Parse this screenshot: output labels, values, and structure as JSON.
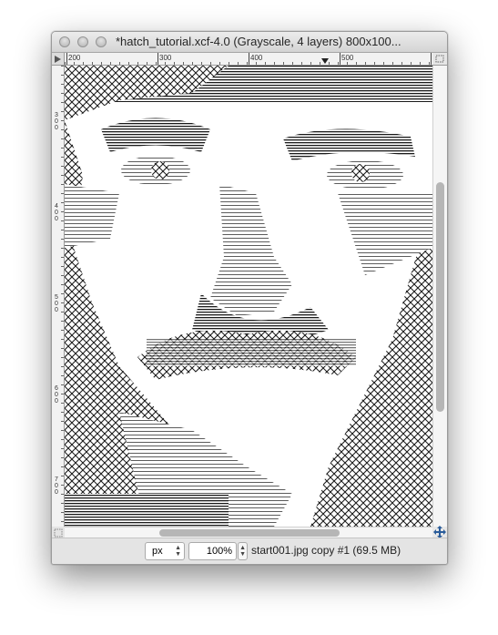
{
  "window": {
    "title": "*hatch_tutorial.xcf-4.0 (Grayscale, 4 layers) 800x100..."
  },
  "traffic_lights": [
    "close",
    "minimize",
    "zoom"
  ],
  "ruler": {
    "horizontal_labels": [
      "200",
      "300",
      "400",
      "500"
    ],
    "vertical_labels": [
      "300",
      "400",
      "500",
      "600",
      "700"
    ]
  },
  "canvas": {
    "image_description_icon": "hatched-engraving-portrait"
  },
  "statusbar": {
    "unit": "px",
    "zoom": "100%",
    "info": "start001.jpg copy #1 (69.5 MB)"
  },
  "icons": {
    "menu_triangle": "quick-mask-menu-icon",
    "navigate": "navigate-move-icon"
  },
  "colors": {
    "ink": "#1a1a1a",
    "paper": "#ffffff",
    "chrome": "#e8e8e8"
  }
}
